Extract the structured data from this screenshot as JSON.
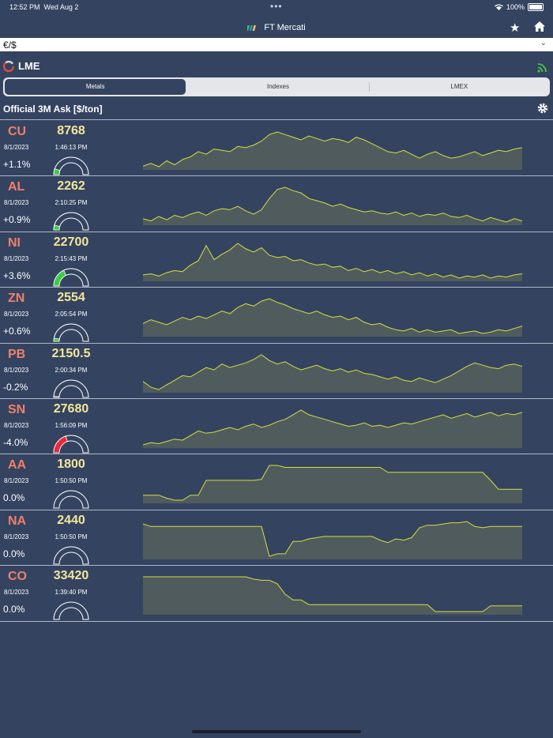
{
  "status": {
    "time": "12:52 PM",
    "date": "Wed Aug 2",
    "battery": "100%"
  },
  "app_title": "FT Mercati",
  "currency": "€/$",
  "exchange": "LME",
  "tabs": [
    "Metals",
    "Indexes",
    "LMEX"
  ],
  "section_title": "Official 3M Ask [$/ton]",
  "colors": {
    "background": "#344360",
    "symbol": "#f0806a",
    "price": "#f3e69a",
    "up": "#3fc94a",
    "down": "#e8283c",
    "spark_line": "#d6e03c",
    "spark_fill": "#505b5e"
  },
  "metals": [
    {
      "symbol": "CU",
      "date": "8/1/2023",
      "change": "+1.1%",
      "price": "8768",
      "time": "1:46:13 PM",
      "gauge": 0.11,
      "spark": [
        48,
        52,
        47,
        56,
        50,
        58,
        62,
        70,
        66,
        74,
        72,
        70,
        78,
        76,
        80,
        86,
        96,
        100,
        96,
        92,
        88,
        94,
        90,
        86,
        90,
        88,
        84,
        92,
        88,
        82,
        76,
        70,
        68,
        72,
        66,
        60,
        66,
        70,
        64,
        60,
        62,
        66,
        70,
        64,
        68,
        72,
        70,
        74,
        76
      ]
    },
    {
      "symbol": "AL",
      "date": "8/1/2023",
      "change": "+0.9%",
      "price": "2262",
      "time": "2:10:25 PM",
      "gauge": 0.09,
      "spark": [
        44,
        40,
        48,
        42,
        50,
        46,
        52,
        56,
        50,
        58,
        62,
        60,
        66,
        58,
        52,
        60,
        80,
        96,
        100,
        94,
        90,
        80,
        76,
        72,
        66,
        70,
        64,
        60,
        56,
        58,
        54,
        52,
        56,
        50,
        54,
        48,
        52,
        50,
        54,
        48,
        46,
        50,
        44,
        40,
        46,
        42,
        38,
        44,
        40
      ]
    },
    {
      "symbol": "NI",
      "date": "8/1/2023",
      "change": "+3.6%",
      "price": "22700",
      "time": "2:15:43 PM",
      "gauge": 0.36,
      "spark": [
        42,
        44,
        40,
        46,
        50,
        48,
        60,
        68,
        96,
        70,
        80,
        88,
        100,
        90,
        84,
        92,
        78,
        74,
        76,
        68,
        70,
        64,
        60,
        62,
        56,
        58,
        50,
        54,
        48,
        52,
        46,
        50,
        44,
        48,
        42,
        46,
        40,
        44,
        38,
        42,
        36,
        40,
        38,
        42,
        36,
        40,
        38,
        42,
        44
      ]
    },
    {
      "symbol": "ZN",
      "date": "8/1/2023",
      "change": "+0.6%",
      "price": "2554",
      "time": "2:05:54 PM",
      "gauge": 0.06,
      "spark": [
        60,
        66,
        62,
        58,
        64,
        70,
        66,
        72,
        68,
        74,
        80,
        76,
        86,
        92,
        88,
        96,
        100,
        94,
        90,
        84,
        80,
        76,
        80,
        74,
        70,
        72,
        66,
        70,
        62,
        58,
        60,
        54,
        50,
        48,
        52,
        46,
        50,
        46,
        48,
        50,
        44,
        46,
        48,
        44,
        46,
        50,
        48,
        52,
        56
      ]
    },
    {
      "symbol": "PB",
      "date": "8/1/2023",
      "change": "-0.2%",
      "price": "2150.5",
      "time": "2:00:34 PM",
      "gauge": 0.02,
      "spark": [
        50,
        40,
        36,
        44,
        52,
        60,
        58,
        66,
        74,
        70,
        80,
        74,
        78,
        82,
        88,
        96,
        86,
        80,
        84,
        76,
        70,
        74,
        78,
        72,
        68,
        72,
        66,
        70,
        64,
        62,
        58,
        54,
        58,
        52,
        50,
        56,
        52,
        48,
        54,
        60,
        68,
        76,
        82,
        78,
        74,
        72,
        78,
        80,
        76
      ]
    },
    {
      "symbol": "SN",
      "date": "8/1/2023",
      "change": "-4.0%",
      "price": "27680",
      "time": "1:56:09 PM",
      "gauge": 0.4,
      "spark": [
        40,
        44,
        42,
        46,
        50,
        48,
        56,
        64,
        60,
        62,
        66,
        70,
        66,
        72,
        76,
        70,
        74,
        80,
        84,
        92,
        100,
        92,
        88,
        84,
        80,
        76,
        72,
        74,
        78,
        72,
        74,
        70,
        74,
        78,
        76,
        80,
        84,
        88,
        92,
        86,
        90,
        94,
        88,
        92,
        96,
        90,
        94,
        92,
        96
      ]
    },
    {
      "symbol": "AA",
      "date": "8/1/2023",
      "change": "0.0%",
      "price": "1800",
      "time": "1:50:50 PM",
      "gauge": 0.0,
      "spark": [
        40,
        40,
        40,
        34,
        30,
        30,
        40,
        40,
        70,
        70,
        70,
        70,
        70,
        70,
        70,
        72,
        100,
        100,
        96,
        96,
        96,
        96,
        96,
        96,
        96,
        96,
        96,
        96,
        96,
        96,
        96,
        86,
        86,
        86,
        86,
        86,
        86,
        86,
        86,
        86,
        86,
        86,
        86,
        86,
        70,
        52,
        52,
        52,
        52
      ]
    },
    {
      "symbol": "NA",
      "date": "8/1/2023",
      "change": "0.0%",
      "price": "2440",
      "time": "1:50:50 PM",
      "gauge": 0.0,
      "spark": [
        72,
        68,
        68,
        68,
        68,
        68,
        68,
        68,
        68,
        68,
        68,
        68,
        68,
        68,
        68,
        68,
        20,
        24,
        24,
        44,
        44,
        48,
        50,
        52,
        52,
        52,
        52,
        52,
        52,
        52,
        46,
        42,
        48,
        46,
        50,
        66,
        70,
        70,
        72,
        74,
        74,
        76,
        68,
        66,
        68,
        68,
        68,
        68,
        68
      ]
    },
    {
      "symbol": "CO",
      "date": "8/1/2023",
      "change": "0.0%",
      "price": "33420",
      "time": "1:39:40 PM",
      "gauge": 0.0,
      "spark": [
        100,
        100,
        100,
        100,
        100,
        100,
        100,
        100,
        100,
        100,
        100,
        100,
        100,
        100,
        96,
        94,
        94,
        88,
        70,
        60,
        60,
        52,
        52,
        52,
        52,
        52,
        52,
        52,
        52,
        52,
        52,
        52,
        52,
        52,
        52,
        52,
        52,
        40,
        40,
        40,
        40,
        40,
        40,
        40,
        50,
        50,
        50,
        50,
        50
      ]
    }
  ]
}
